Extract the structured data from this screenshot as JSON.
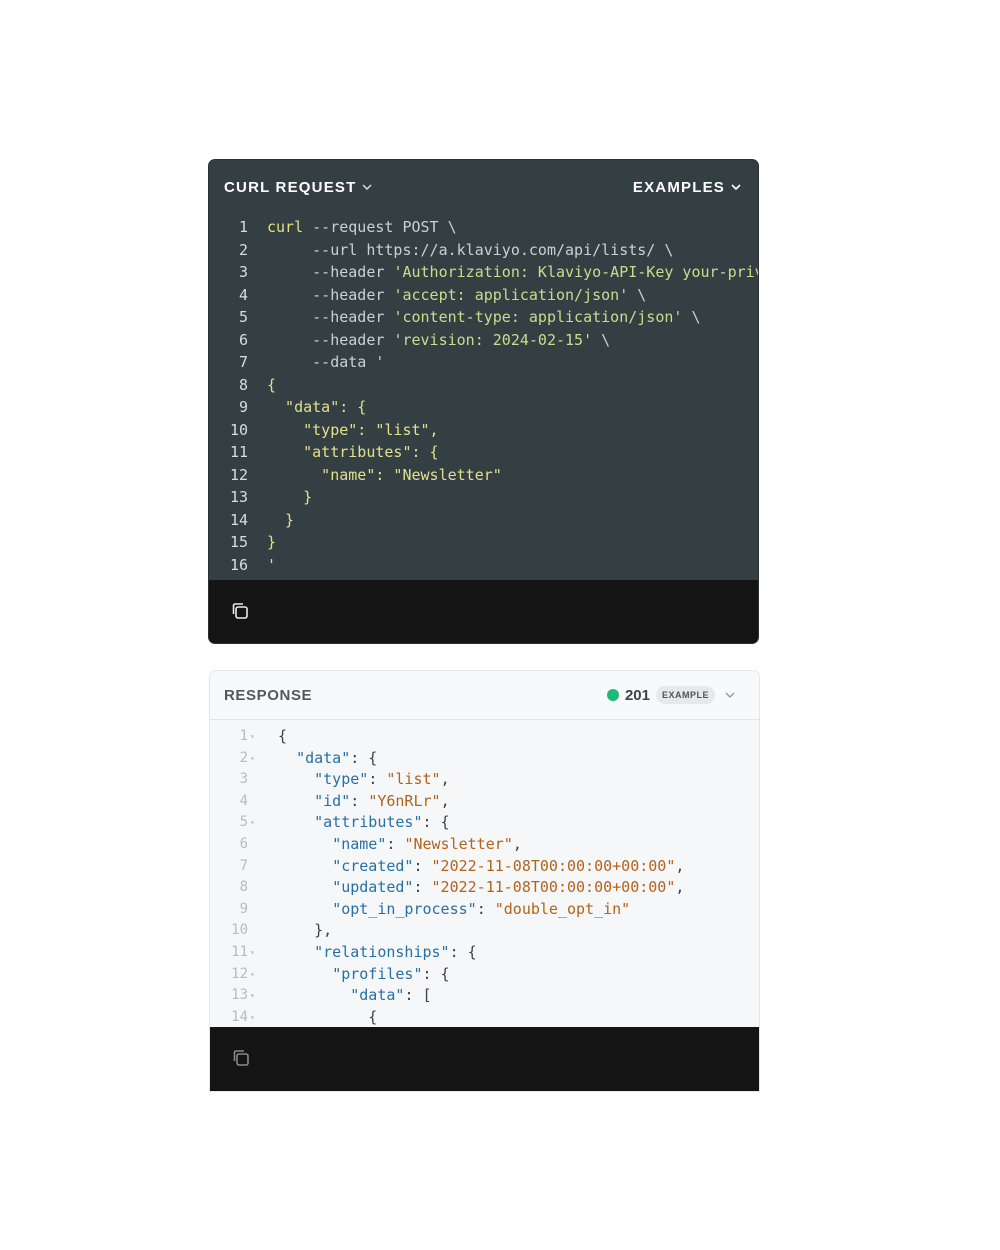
{
  "request": {
    "title": "CURL REQUEST",
    "examples_label": "EXAMPLES",
    "lines": [
      {
        "n": "1",
        "parts": [
          {
            "t": "curl",
            "c": "cmd"
          },
          {
            "t": " --request POST \\",
            "c": "flag"
          }
        ]
      },
      {
        "n": "2",
        "parts": [
          {
            "t": "     --url https://a.klaviyo.com/api/lists/ \\",
            "c": "flag"
          }
        ]
      },
      {
        "n": "3",
        "parts": [
          {
            "t": "     --header ",
            "c": "flag"
          },
          {
            "t": "'Authorization: Klaviyo-API-Key your-private-api-key'",
            "c": "str"
          },
          {
            "t": " \\",
            "c": "flag"
          }
        ]
      },
      {
        "n": "4",
        "parts": [
          {
            "t": "     --header ",
            "c": "flag"
          },
          {
            "t": "'accept: application/json'",
            "c": "str"
          },
          {
            "t": " \\",
            "c": "flag"
          }
        ]
      },
      {
        "n": "5",
        "parts": [
          {
            "t": "     --header ",
            "c": "flag"
          },
          {
            "t": "'content-type: application/json'",
            "c": "str"
          },
          {
            "t": " \\",
            "c": "flag"
          }
        ]
      },
      {
        "n": "6",
        "parts": [
          {
            "t": "     --header ",
            "c": "flag"
          },
          {
            "t": "'revision: 2024-02-15'",
            "c": "str"
          },
          {
            "t": " \\",
            "c": "flag"
          }
        ]
      },
      {
        "n": "7",
        "parts": [
          {
            "t": "     --data ",
            "c": "flag"
          },
          {
            "t": "'",
            "c": "str"
          }
        ]
      },
      {
        "n": "8",
        "parts": [
          {
            "t": "{",
            "c": "yel"
          }
        ]
      },
      {
        "n": "9",
        "parts": [
          {
            "t": "  \"data\": {",
            "c": "yel"
          }
        ]
      },
      {
        "n": "10",
        "parts": [
          {
            "t": "    \"type\": \"list\",",
            "c": "yel"
          }
        ]
      },
      {
        "n": "11",
        "parts": [
          {
            "t": "    \"attributes\": {",
            "c": "yel"
          }
        ]
      },
      {
        "n": "12",
        "parts": [
          {
            "t": "      \"name\": \"Newsletter\"",
            "c": "yel"
          }
        ]
      },
      {
        "n": "13",
        "parts": [
          {
            "t": "    }",
            "c": "yel"
          }
        ]
      },
      {
        "n": "14",
        "parts": [
          {
            "t": "  }",
            "c": "yel"
          }
        ]
      },
      {
        "n": "15",
        "parts": [
          {
            "t": "}",
            "c": "yel"
          }
        ]
      },
      {
        "n": "16",
        "parts": [
          {
            "t": "'",
            "c": "yel"
          }
        ]
      }
    ],
    "copy_icon": "copy-icon"
  },
  "response": {
    "title": "RESPONSE",
    "status_code": "201",
    "status_color": "#1fb978",
    "badge": "EXAMPLE",
    "lines": [
      {
        "n": "1",
        "fold": true,
        "parts": [
          {
            "t": "{",
            "c": "plain"
          }
        ]
      },
      {
        "n": "2",
        "fold": true,
        "parts": [
          {
            "t": "  ",
            "c": "plain"
          },
          {
            "t": "\"data\"",
            "c": "key"
          },
          {
            "t": ": {",
            "c": "plain"
          }
        ]
      },
      {
        "n": "3",
        "fold": false,
        "parts": [
          {
            "t": "    ",
            "c": "plain"
          },
          {
            "t": "\"type\"",
            "c": "key"
          },
          {
            "t": ": ",
            "c": "plain"
          },
          {
            "t": "\"list\"",
            "c": "str"
          },
          {
            "t": ",",
            "c": "plain"
          }
        ]
      },
      {
        "n": "4",
        "fold": false,
        "parts": [
          {
            "t": "    ",
            "c": "plain"
          },
          {
            "t": "\"id\"",
            "c": "key"
          },
          {
            "t": ": ",
            "c": "plain"
          },
          {
            "t": "\"Y6nRLr\"",
            "c": "str"
          },
          {
            "t": ",",
            "c": "plain"
          }
        ]
      },
      {
        "n": "5",
        "fold": true,
        "parts": [
          {
            "t": "    ",
            "c": "plain"
          },
          {
            "t": "\"attributes\"",
            "c": "key"
          },
          {
            "t": ": {",
            "c": "plain"
          }
        ]
      },
      {
        "n": "6",
        "fold": false,
        "parts": [
          {
            "t": "      ",
            "c": "plain"
          },
          {
            "t": "\"name\"",
            "c": "key"
          },
          {
            "t": ": ",
            "c": "plain"
          },
          {
            "t": "\"Newsletter\"",
            "c": "str"
          },
          {
            "t": ",",
            "c": "plain"
          }
        ]
      },
      {
        "n": "7",
        "fold": false,
        "parts": [
          {
            "t": "      ",
            "c": "plain"
          },
          {
            "t": "\"created\"",
            "c": "key"
          },
          {
            "t": ": ",
            "c": "plain"
          },
          {
            "t": "\"2022-11-08T00:00:00+00:00\"",
            "c": "str"
          },
          {
            "t": ",",
            "c": "plain"
          }
        ]
      },
      {
        "n": "8",
        "fold": false,
        "parts": [
          {
            "t": "      ",
            "c": "plain"
          },
          {
            "t": "\"updated\"",
            "c": "key"
          },
          {
            "t": ": ",
            "c": "plain"
          },
          {
            "t": "\"2022-11-08T00:00:00+00:00\"",
            "c": "str"
          },
          {
            "t": ",",
            "c": "plain"
          }
        ]
      },
      {
        "n": "9",
        "fold": false,
        "parts": [
          {
            "t": "      ",
            "c": "plain"
          },
          {
            "t": "\"opt_in_process\"",
            "c": "key"
          },
          {
            "t": ": ",
            "c": "plain"
          },
          {
            "t": "\"double_opt_in\"",
            "c": "str"
          }
        ]
      },
      {
        "n": "10",
        "fold": false,
        "parts": [
          {
            "t": "    },",
            "c": "plain"
          }
        ]
      },
      {
        "n": "11",
        "fold": true,
        "parts": [
          {
            "t": "    ",
            "c": "plain"
          },
          {
            "t": "\"relationships\"",
            "c": "key"
          },
          {
            "t": ": {",
            "c": "plain"
          }
        ]
      },
      {
        "n": "12",
        "fold": true,
        "parts": [
          {
            "t": "      ",
            "c": "plain"
          },
          {
            "t": "\"profiles\"",
            "c": "key"
          },
          {
            "t": ": {",
            "c": "plain"
          }
        ]
      },
      {
        "n": "13",
        "fold": true,
        "parts": [
          {
            "t": "        ",
            "c": "plain"
          },
          {
            "t": "\"data\"",
            "c": "key"
          },
          {
            "t": ": [",
            "c": "plain"
          }
        ]
      },
      {
        "n": "14",
        "fold": true,
        "parts": [
          {
            "t": "          {",
            "c": "plain"
          }
        ]
      }
    ],
    "copy_icon": "copy-icon"
  }
}
